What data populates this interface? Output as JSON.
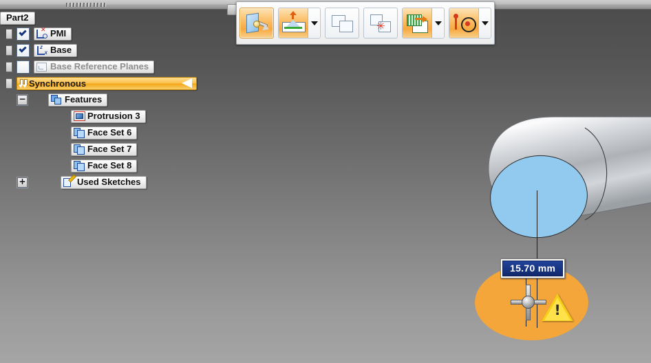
{
  "window": {
    "title_tab": "Part2",
    "grip_icon": "window-grip-icon"
  },
  "toolbar": {
    "name": "synchronous-modeling-toolbar",
    "handle_icon": "toolbar-drag-handle-icon",
    "buttons": [
      {
        "id": "move-face",
        "icon": "move-face-icon",
        "label": "Move Face",
        "active": true,
        "has_dropdown": false
      },
      {
        "id": "draft",
        "icon": "draft-face-icon",
        "label": "Draft",
        "active": true,
        "has_dropdown": true
      },
      {
        "id": "copy-face",
        "icon": "copy-face-icon",
        "label": "Copy",
        "active": false,
        "has_dropdown": false
      },
      {
        "id": "delete-face",
        "icon": "delete-face-icon",
        "label": "Delete Face",
        "active": false,
        "has_dropdown": false
      },
      {
        "id": "thin-wall-region",
        "icon": "thin-wall-region-icon",
        "label": "Thin Wall Region",
        "active": true,
        "has_dropdown": true
      },
      {
        "id": "axis-relate",
        "icon": "axial-relate-icon",
        "label": "Axial Relate",
        "active": true,
        "has_dropdown": true
      }
    ],
    "dropdown_icon": "chevron-down-icon"
  },
  "tree": {
    "name": "model-pathfinder-tree",
    "rows": [
      {
        "id": "pmi",
        "label": "PMI",
        "icon": "pmi-icon",
        "checkbox": "checked",
        "indent": 0,
        "expander": "plus-stub",
        "dim": false,
        "highlight": false
      },
      {
        "id": "base",
        "label": "Base",
        "icon": "coordinate-axes-icon",
        "checkbox": "checked",
        "indent": 0,
        "expander": "plus-stub",
        "dim": false,
        "highlight": false
      },
      {
        "id": "base-ref",
        "label": "Base Reference Planes",
        "icon": "reference-plane-icon",
        "checkbox": "unchecked",
        "indent": 0,
        "expander": "plus-stub",
        "dim": true,
        "highlight": false
      },
      {
        "id": "synchronous",
        "label": "Synchronous",
        "icon": "synchronous-icon",
        "checkbox": "none",
        "indent": 0,
        "expander": "plus-stub",
        "dim": false,
        "highlight": true
      },
      {
        "id": "features",
        "label": "Features",
        "icon": "features-icon",
        "checkbox": "none",
        "indent": 1,
        "expander": "minus",
        "dim": false,
        "highlight": false
      },
      {
        "id": "protrusion-3",
        "label": "Protrusion 3",
        "icon": "protrusion-icon",
        "checkbox": "none",
        "indent": 3,
        "expander": "none",
        "dim": false,
        "highlight": false
      },
      {
        "id": "face-set-6",
        "label": "Face Set 6",
        "icon": "face-set-icon",
        "checkbox": "none",
        "indent": 3,
        "expander": "none",
        "dim": false,
        "highlight": false
      },
      {
        "id": "face-set-7",
        "label": "Face Set 7",
        "icon": "face-set-icon",
        "checkbox": "none",
        "indent": 3,
        "expander": "none",
        "dim": false,
        "highlight": false
      },
      {
        "id": "face-set-8",
        "label": "Face Set 8",
        "icon": "face-set-icon",
        "checkbox": "none",
        "indent": 3,
        "expander": "none",
        "dim": false,
        "highlight": false
      },
      {
        "id": "used-sketches",
        "label": "Used Sketches",
        "icon": "sketch-icon",
        "checkbox": "none",
        "indent": 1,
        "expander": "plus",
        "dim": false,
        "highlight": false
      }
    ],
    "collapse_glyph": "−",
    "expand_glyph": "+",
    "sync_arrow_icon": "left-triangle-marker-icon"
  },
  "viewport": {
    "name": "graphics-window",
    "background_top": "#4b4b4b",
    "background_bottom": "#a5a5a5",
    "selected_face_color": "#92c9ee",
    "highlight_face_color": "#f5a63a",
    "body_color": "#cfd2d6"
  },
  "dimension": {
    "name": "live-dimension",
    "value": "15.70 mm",
    "text_color": "#ffffff",
    "field_color": "#16307d"
  },
  "handle": {
    "name": "steering-wheel-handle",
    "icon": "move-handle-icon"
  },
  "warning": {
    "name": "warning-badge",
    "icon": "warning-triangle-icon",
    "glyph": "!",
    "color": "#f5cc17"
  }
}
